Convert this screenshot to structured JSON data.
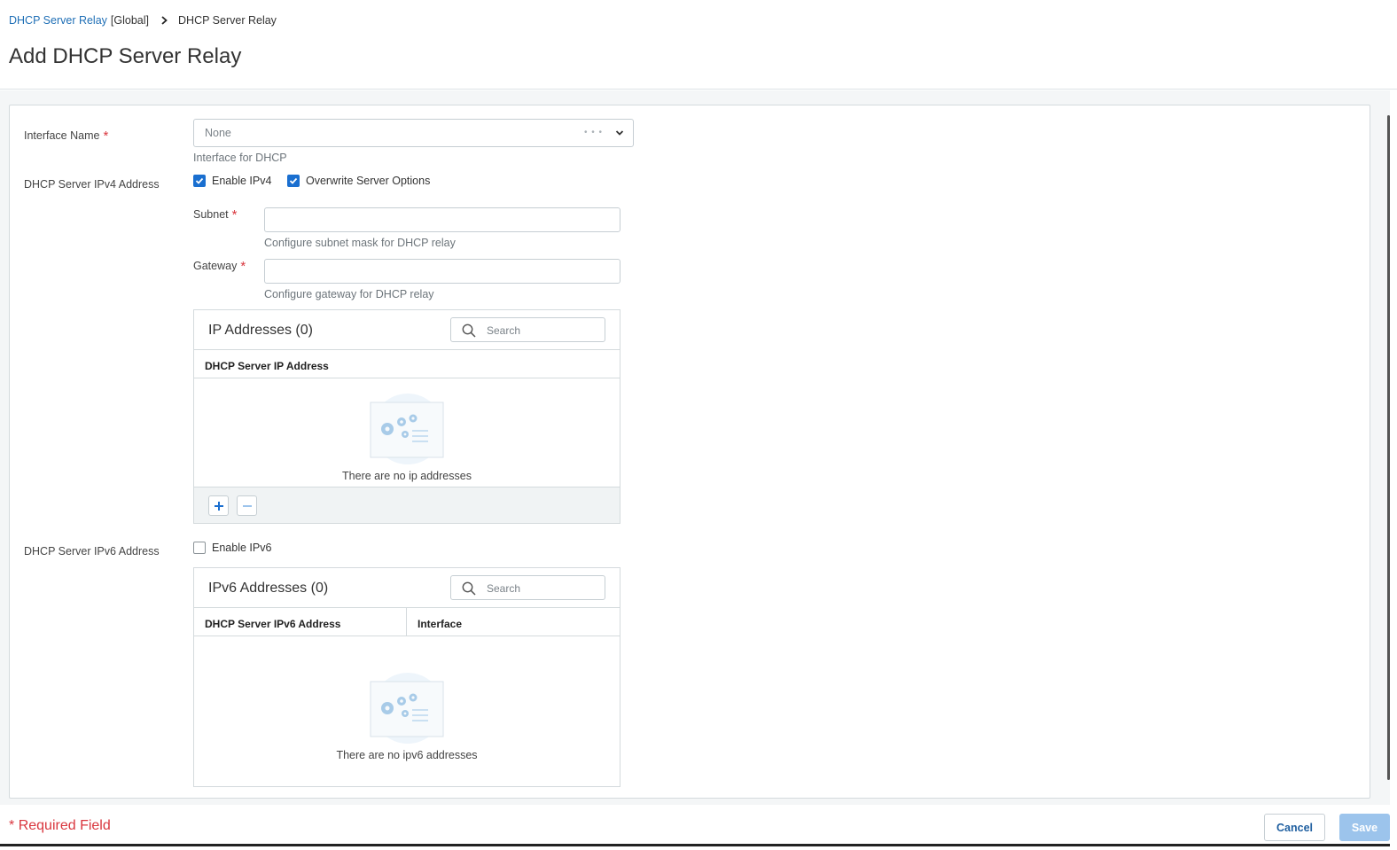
{
  "breadcrumb": {
    "link": "DHCP Server Relay",
    "scope": "[Global]",
    "current": "DHCP Server Relay"
  },
  "page_title": "Add DHCP Server Relay",
  "interface": {
    "label": "Interface Name",
    "required_mark": "*",
    "value": "None",
    "dots": "• • •",
    "help": "Interface for DHCP"
  },
  "ipv4": {
    "label": "DHCP Server IPv4 Address",
    "enable_label": "Enable IPv4",
    "enable_checked": true,
    "overwrite_label": "Overwrite Server Options",
    "overwrite_checked": true,
    "subnet_label": "Subnet",
    "subnet_value": "",
    "subnet_help": "Configure subnet mask for DHCP relay",
    "gateway_label": "Gateway",
    "gateway_value": "",
    "gateway_help": "Configure gateway for DHCP relay",
    "grid": {
      "title": "IP Addresses (0)",
      "search_placeholder": "Search",
      "columns": [
        "DHCP Server IP Address"
      ],
      "empty_text": "There are no ip addresses"
    }
  },
  "ipv6": {
    "label": "DHCP Server IPv6 Address",
    "enable_label": "Enable IPv6",
    "enable_checked": false,
    "grid": {
      "title": "IPv6 Addresses (0)",
      "search_placeholder": "Search",
      "columns": [
        "DHCP Server IPv6 Address",
        "Interface"
      ],
      "empty_text": "There are no ipv6 addresses"
    }
  },
  "footer": {
    "required_note": "Required Field",
    "required_mark": "*",
    "cancel_label": "Cancel",
    "save_label": "Save"
  },
  "colors": {
    "link": "#1f6fb6",
    "accent": "#1a6fd0",
    "required": "#d9363e",
    "save_disabled": "#9cc4ec"
  },
  "icons": [
    "chevron-right-icon",
    "chevron-down-icon",
    "checkmark-icon",
    "search-icon",
    "gears-illustration-icon",
    "plus-icon",
    "minus-icon"
  ]
}
